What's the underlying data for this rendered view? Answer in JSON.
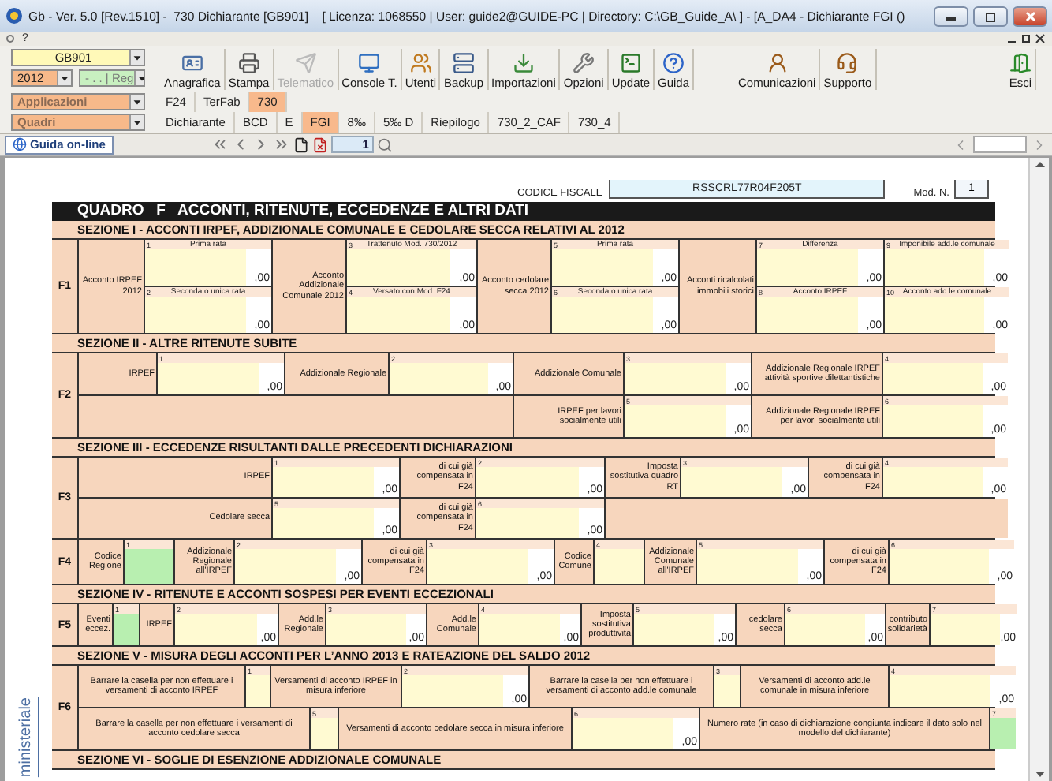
{
  "window": {
    "title": "Gb - Ver. 5.0 [Rev.1510] -  730 Dichiarante [GB901]    [ Licenza: 1068550 | User: guide2@GUIDE-PC | Directory: C:\\GB_Guide_A\\ ] - [A_DA4 - Dichiarante FGI ()"
  },
  "menu": {
    "items": [
      "?"
    ]
  },
  "toolbar": {
    "company": "GB901",
    "year": "2012",
    "register": "- . . | Reg",
    "applications": "Applicazioni",
    "frames": "Quadri",
    "buttons": [
      {
        "label": "Anagrafica",
        "disabled": false
      },
      {
        "label": "Stampa",
        "disabled": false
      },
      {
        "label": "Telematico",
        "disabled": true
      },
      {
        "label": "Console T.",
        "disabled": false
      },
      {
        "label": "Utenti",
        "disabled": false
      },
      {
        "label": "Backup",
        "disabled": false
      },
      {
        "label": "Importazioni",
        "disabled": false
      },
      {
        "label": "Opzioni",
        "disabled": false
      },
      {
        "label": "Update",
        "disabled": false
      },
      {
        "label": "Guida",
        "disabled": false
      }
    ],
    "right_buttons": [
      "Comunicazioni",
      "Supporto"
    ],
    "exit": "Esci"
  },
  "app_tabs": [
    {
      "label": "F24",
      "selected": false
    },
    {
      "label": "TerFab",
      "selected": false
    },
    {
      "label": "730",
      "selected": true
    }
  ],
  "frame_tabs": [
    {
      "label": "Dichiarante",
      "selected": false
    },
    {
      "label": "BCD",
      "selected": false
    },
    {
      "label": "E",
      "selected": false
    },
    {
      "label": "FGI",
      "selected": true
    },
    {
      "label": "8‰",
      "selected": false
    },
    {
      "label": "5‰ D",
      "selected": false
    },
    {
      "label": "Riepilogo",
      "selected": false
    },
    {
      "label": "730_2_CAF",
      "selected": false
    },
    {
      "label": "730_4",
      "selected": false
    }
  ],
  "nav": {
    "help": "Guida on-line",
    "page": "1"
  },
  "form": {
    "tax_code_label": "CODICE FISCALE",
    "tax_code": "RSSCRL77R04F205T",
    "model_label": "Mod. N.",
    "model": "1",
    "title": "QUADRO   F   ACCONTI, RITENUTE, ECCEDENZE E ALTRI DATI",
    "blocks": [
      {
        "kind": "section",
        "title": "SEZIONE I  -  ACCONTI IRPEF, ADDIZIONALE COMUNALE E CEDOLARE SECCA RELATIVI AL 2012"
      },
      {
        "kind": "row",
        "code": "F1",
        "cells": [
          {
            "kind": "label",
            "text": "Acconto IRPEF 2012"
          },
          {
            "kind": "amount",
            "number": "1",
            "caption": "Prima rata",
            "value": ",00"
          },
          {
            "kind": "amount",
            "number": "2",
            "caption": "Seconda o unica rata",
            "value": ",00"
          },
          {
            "kind": "label",
            "text": "Acconto Addizionale Comunale 2012"
          },
          {
            "kind": "amount",
            "number": "3",
            "caption": "Trattenuto Mod. 730/2012",
            "value": ",00"
          },
          {
            "kind": "amount",
            "number": "4",
            "caption": "Versato con Mod. F24",
            "value": ",00"
          },
          {
            "kind": "label",
            "text": "Acconto cedolare secca 2012"
          },
          {
            "kind": "amount",
            "number": "5",
            "caption": "Prima rata",
            "value": ",00"
          },
          {
            "kind": "amount",
            "number": "6",
            "caption": "Seconda o unica rata",
            "value": ",00"
          },
          {
            "kind": "label",
            "text": "Acconti ricalcolati immobili storici"
          },
          {
            "kind": "amount",
            "number": "7",
            "caption": "Differenza",
            "value": ",00"
          },
          {
            "kind": "amount",
            "number": "9",
            "caption": "Imponibile add.le comunale",
            "value": ",00"
          },
          {
            "kind": "amount",
            "number": "8",
            "caption": "Acconto IRPEF",
            "value": ",00"
          },
          {
            "kind": "amount",
            "number": "10",
            "caption": "Acconto add.le comunale",
            "value": ",00"
          }
        ]
      },
      {
        "kind": "section",
        "title": "SEZIONE II  -  ALTRE RITENUTE SUBITE"
      },
      {
        "kind": "row",
        "code": "F2",
        "cells": [
          {
            "kind": "label",
            "text": "IRPEF"
          },
          {
            "kind": "amount",
            "number": "1",
            "value": ",00"
          },
          {
            "kind": "label",
            "text": "Addizionale Regionale"
          },
          {
            "kind": "amount",
            "number": "2",
            "value": ",00"
          },
          {
            "kind": "label",
            "text": "Addizionale Comunale"
          },
          {
            "kind": "amount",
            "number": "3",
            "value": ",00"
          },
          {
            "kind": "label",
            "text": "Addizionale Regionale IRPEF attività sportive dilettantistiche"
          },
          {
            "kind": "amount",
            "number": "4",
            "value": ",00"
          },
          {
            "kind": "label",
            "text": "IRPEF per lavori socialmente utili"
          },
          {
            "kind": "amount",
            "number": "5",
            "value": ",00"
          },
          {
            "kind": "label",
            "text": "Addizionale Regionale IRPEF per lavori socialmente utili"
          },
          {
            "kind": "amount",
            "number": "6",
            "value": ",00"
          }
        ]
      },
      {
        "kind": "section",
        "title": "SEZIONE III  -  ECCEDENZE RISULTANTI DALLE PRECEDENTI DICHIARAZIONI"
      },
      {
        "kind": "row",
        "code": "F3",
        "cells": [
          {
            "kind": "label",
            "text": "IRPEF"
          },
          {
            "kind": "amount",
            "number": "1",
            "value": ",00"
          },
          {
            "kind": "label",
            "text": "di cui già compensata in F24"
          },
          {
            "kind": "amount",
            "number": "2",
            "value": ",00"
          },
          {
            "kind": "label",
            "text": "Imposta sostitutiva quadro  RT"
          },
          {
            "kind": "amount",
            "number": "3",
            "value": ",00"
          },
          {
            "kind": "label",
            "text": "di cui già compensata in F24"
          },
          {
            "kind": "amount",
            "number": "4",
            "value": ",00"
          },
          {
            "kind": "label",
            "text": "Cedolare secca"
          },
          {
            "kind": "amount",
            "number": "5",
            "value": ",00"
          },
          {
            "kind": "label",
            "text": "di cui già compensata in F24"
          },
          {
            "kind": "amount",
            "number": "6",
            "value": ",00"
          }
        ]
      },
      {
        "kind": "row",
        "code": "F4",
        "cells": [
          {
            "kind": "label",
            "text": "Codice Regione"
          },
          {
            "kind": "select",
            "number": "1"
          },
          {
            "kind": "label",
            "text": "Addizionale Regionale all'IRPEF"
          },
          {
            "kind": "amount",
            "number": "2",
            "value": ",00"
          },
          {
            "kind": "label",
            "text": "di cui già compensata in F24"
          },
          {
            "kind": "amount",
            "number": "3",
            "value": ",00"
          },
          {
            "kind": "label",
            "text": "Codice Comune"
          },
          {
            "kind": "check",
            "number": "4"
          },
          {
            "kind": "label",
            "text": "Addizionale Comunale all'IRPEF"
          },
          {
            "kind": "amount",
            "number": "5",
            "value": ",00"
          },
          {
            "kind": "label",
            "text": "di cui già compensata in F24"
          },
          {
            "kind": "amount",
            "number": "6",
            "value": ",00"
          }
        ]
      },
      {
        "kind": "section",
        "title": "SEZIONE IV  -  RITENUTE E ACCONTI SOSPESI PER EVENTI ECCEZIONALI"
      },
      {
        "kind": "row",
        "code": "F5",
        "cells": [
          {
            "kind": "label",
            "text": "Eventi eccez."
          },
          {
            "kind": "select",
            "number": "1"
          },
          {
            "kind": "label",
            "text": "IRPEF"
          },
          {
            "kind": "amount",
            "number": "2",
            "value": ",00"
          },
          {
            "kind": "label",
            "text": "Add.le Regionale"
          },
          {
            "kind": "amount",
            "number": "3",
            "value": ",00"
          },
          {
            "kind": "label",
            "text": "Add.le Comunale"
          },
          {
            "kind": "amount",
            "number": "4",
            "value": ",00"
          },
          {
            "kind": "label",
            "text": "Imposta sostitutiva produttività"
          },
          {
            "kind": "amount",
            "number": "5",
            "value": ",00"
          },
          {
            "kind": "label",
            "text": "cedolare secca"
          },
          {
            "kind": "amount",
            "number": "6",
            "value": ",00"
          },
          {
            "kind": "label",
            "text": "contributo solidarietà"
          },
          {
            "kind": "amount",
            "number": "7",
            "value": ",00"
          }
        ]
      },
      {
        "kind": "section",
        "title": "SEZIONE V  -  MISURA DEGLI ACCONTI PER L’ANNO 2013 E RATEAZIONE DEL SALDO 2012"
      },
      {
        "kind": "row",
        "code": "F6",
        "cells": [
          {
            "kind": "label",
            "text": "Barrare la casella per non effettuare i versamenti di acconto IRPEF"
          },
          {
            "kind": "check",
            "number": "1"
          },
          {
            "kind": "label",
            "text": "Versamenti di acconto IRPEF in misura inferiore"
          },
          {
            "kind": "amount",
            "number": "2",
            "value": ",00"
          },
          {
            "kind": "label",
            "text": "Barrare la casella per non effettuare i versamenti di acconto add.le comunale"
          },
          {
            "kind": "check",
            "number": "3"
          },
          {
            "kind": "label",
            "text": "Versamenti di acconto add.le comunale in misura inferiore"
          },
          {
            "kind": "amount",
            "number": "4",
            "value": ",00"
          },
          {
            "kind": "label",
            "text": "Barrare la casella per non effettuare i versamenti di acconto cedolare secca"
          },
          {
            "kind": "check",
            "number": "5"
          },
          {
            "kind": "label",
            "text": "Versamenti di acconto cedolare secca in misura inferiore"
          },
          {
            "kind": "amount",
            "number": "6",
            "value": ",00"
          },
          {
            "kind": "label",
            "text": "Numero rate (in caso di dichiarazione congiunta indicare il dato solo nel modello del dichiarante)"
          },
          {
            "kind": "select",
            "number": "7"
          }
        ]
      },
      {
        "kind": "section",
        "title": "SEZIONE VI  -  SOGLIE DI ESENZIONE ADDIZIONALE COMUNALE"
      }
    ]
  },
  "side_label": "ministeriale"
}
